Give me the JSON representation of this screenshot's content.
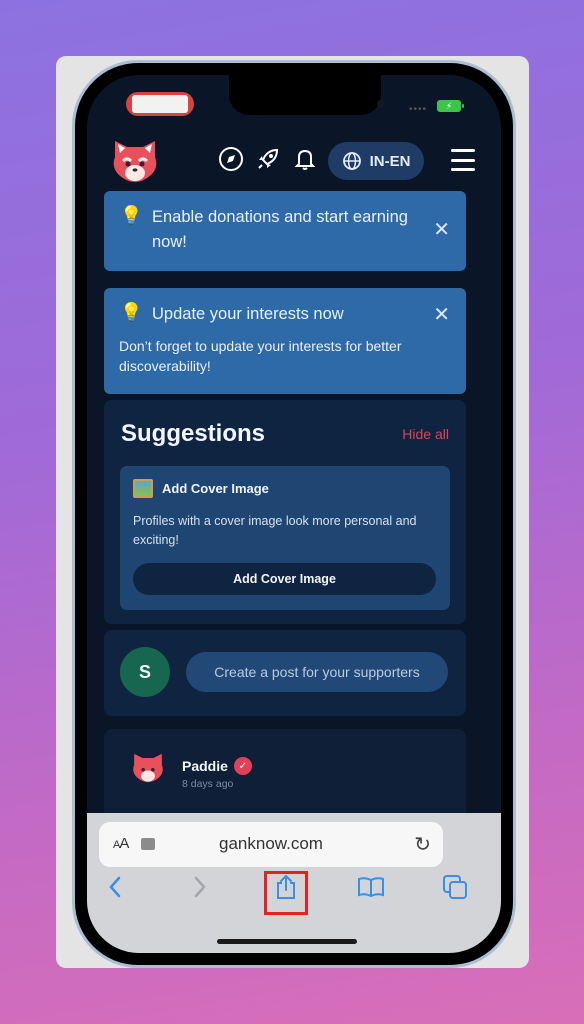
{
  "status_bar": {
    "battery_state": "charging"
  },
  "header": {
    "logo": "red-panda-logo",
    "icons": [
      "compass-icon",
      "rocket-icon",
      "bell-icon"
    ],
    "language_label": "IN-EN",
    "menu": "hamburger-menu-icon"
  },
  "banners": [
    {
      "icon": "lightbulb-icon",
      "title": "Enable donations and start earning now!",
      "description": ""
    },
    {
      "icon": "lightbulb-icon",
      "title": "Update your interests now",
      "description": "Don’t forget to update your interests for better discoverability!"
    }
  ],
  "suggestions": {
    "title": "Suggestions",
    "hide_all_label": "Hide all",
    "cover_card": {
      "icon": "framed-picture-icon",
      "title": "Add Cover Image",
      "description": "Profiles with a cover image look more personal and exciting!",
      "button_label": "Add Cover Image"
    }
  },
  "create_post": {
    "avatar_initial": "S",
    "placeholder": "Create a post for your supporters"
  },
  "feed": {
    "author": "Paddie",
    "verified": true,
    "time": "8 days ago"
  },
  "safari": {
    "text_size_label_small": "A",
    "text_size_label_large": "A",
    "url": "ganknow.com",
    "toolbar": [
      "back-icon",
      "forward-icon",
      "share-icon",
      "bookmarks-icon",
      "tabs-icon"
    ],
    "highlighted": "share-icon"
  },
  "colors": {
    "accent_red": "#d9435a",
    "banner_blue": "#2f6aa8",
    "safari_blue": "#3a8ee6",
    "highlight_box": "#e32222"
  }
}
